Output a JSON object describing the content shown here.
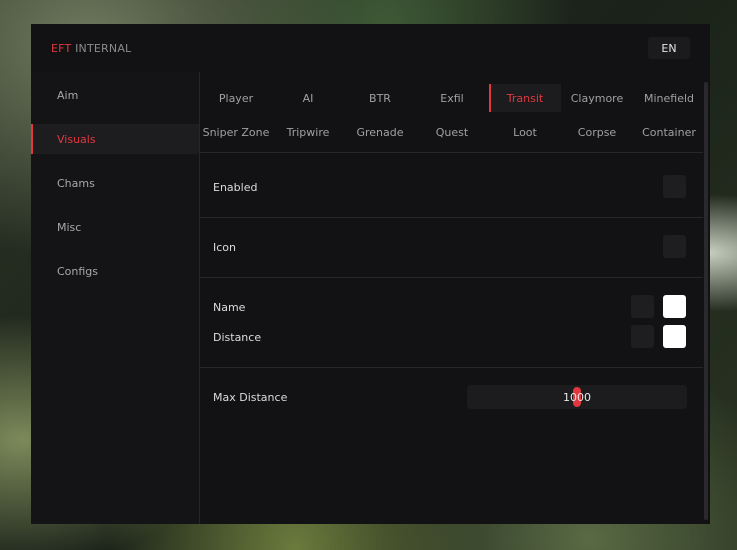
{
  "header": {
    "logo_accent": "EFT",
    "logo_rest": " INTERNAL",
    "language": "EN"
  },
  "sidebar": {
    "items": [
      {
        "label": "Aim",
        "active": false
      },
      {
        "label": "Visuals",
        "active": true
      },
      {
        "label": "Chams",
        "active": false
      },
      {
        "label": "Misc",
        "active": false
      },
      {
        "label": "Configs",
        "active": false
      }
    ]
  },
  "tabs": {
    "row1": [
      "Player",
      "AI",
      "BTR",
      "Exfil",
      "Transit",
      "Claymore",
      "Minefield"
    ],
    "row2": [
      "Sniper Zone",
      "Tripwire",
      "Grenade",
      "Quest",
      "Loot",
      "Corpse",
      "Container"
    ],
    "active": "Transit"
  },
  "settings": {
    "enabled_label": "Enabled",
    "icon_label": "Icon",
    "name_label": "Name",
    "distance_label": "Distance",
    "max_distance_label": "Max Distance",
    "max_distance_value": "1000",
    "max_distance_fraction": 0.5
  },
  "colors": {
    "accent": "#e0383e",
    "window_bg": "#121214",
    "swatch": "#ffffff"
  }
}
